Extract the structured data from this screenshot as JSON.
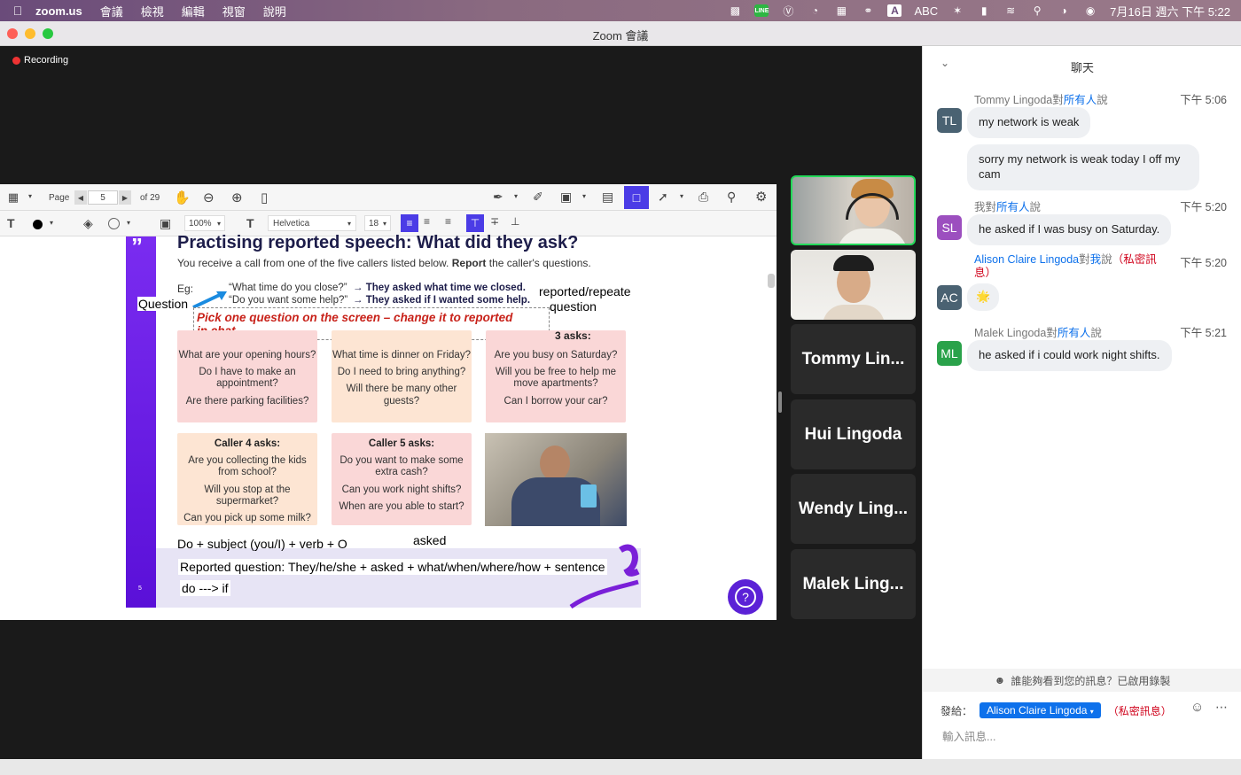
{
  "menubar": {
    "app_name": "zoom.us",
    "items": [
      "會議",
      "檢視",
      "編輯",
      "視窗",
      "說明"
    ],
    "input_method": "ABC",
    "datetime": "7月16日 週六 下午 5:22"
  },
  "window": {
    "title": "Zoom 會議"
  },
  "recording": {
    "label": "Recording"
  },
  "pdf_toolbar": {
    "page_label": "Page",
    "page_number": "5",
    "page_total": "of 29",
    "zoom": "100%",
    "font": "Helvetica",
    "font_size": "18"
  },
  "slide": {
    "title": "Practising reported speech: What did they ask?",
    "subtitle_pre": "You receive a call from one of the five callers listed below.",
    "subtitle_bold": "Report",
    "subtitle_post": "the caller's questions.",
    "eg_label": "Eg:",
    "eg_q1": "“What time do you close?”",
    "eg_a1": "→ They asked what time we closed.",
    "eg_q2": "“Do you want some help?”",
    "eg_a2": "→ They asked if I wanted some help.",
    "annot_question": "Question",
    "annot_reported": "reported/repeate",
    "annot_question2": "question",
    "annot_instruction_1": "Pick one question on the screen – change it to reported",
    "annot_instruction_2": "in chat",
    "caller3_header": "3 asks:",
    "card1": [
      "What are your opening hours?",
      "Do I have to make an appointment?",
      "Are there parking facilities?"
    ],
    "card2": [
      "What time is dinner on Friday?",
      "Do I need to bring anything?",
      "Will there be many other guests?"
    ],
    "card3": [
      "Are you busy on Saturday?",
      "Will you be free to help me move apartments?",
      "Can I borrow your car?"
    ],
    "card4_header": "Caller 4 asks:",
    "card4": [
      "Are you collecting the kids from school?",
      "Will you stop at the supermarket?",
      "Can you pick up some milk?"
    ],
    "card5_header": "Caller 5 asks:",
    "card5": [
      "Do you want to make some extra cash?",
      "Can you work night shifts?",
      "When are you able to start?"
    ],
    "formula1": "Do + subject (you/I) + verb + O",
    "asked": "asked",
    "formula2": "Reported question: They/he/she + asked + what/when/where/how + sentence",
    "formula3": "do ---> if",
    "page_num": "5",
    "help_btn": "?"
  },
  "participants": [
    {
      "name": ""
    },
    {
      "name": ""
    },
    {
      "name": "Tommy Lin..."
    },
    {
      "name": "Hui Lingoda"
    },
    {
      "name": "Wendy Ling..."
    },
    {
      "name": "Malek Ling..."
    }
  ],
  "chat": {
    "title": "聊天",
    "messages": [
      {
        "initials": "TL",
        "sender": "Tommy Lingoda",
        "to_prefix": "對",
        "to": "所有人",
        "suffix": "說",
        "time": "下午 5:06",
        "texts": [
          "my network is weak",
          "sorry my network is weak today I off my cam"
        ],
        "color": "#4a6272"
      },
      {
        "initials": "SL",
        "sender": "我",
        "to_prefix": "對",
        "to": "所有人",
        "suffix": "說",
        "time": "下午 5:20",
        "texts": [
          "he asked if I was busy on Saturday."
        ],
        "color": "#9c4fbf"
      },
      {
        "initials": "AC",
        "sender": "Alison Claire Lingoda",
        "to_prefix": "對",
        "to": "我",
        "suffix": "說",
        "private": "（私密訊息）",
        "time": "下午 5:20",
        "texts": [
          "🌟"
        ],
        "color": "#4a6272"
      },
      {
        "initials": "ML",
        "sender": "Malek Lingoda",
        "to_prefix": "對",
        "to": "所有人",
        "suffix": "說",
        "time": "下午 5:21",
        "texts": [
          "he asked if i could work night shifts."
        ],
        "color": "#2aa24a"
      }
    ],
    "privacy_notice": "誰能夠看到您的訊息？已啟用錄製",
    "send_to_label": "發給：",
    "recipient": "Alison Claire Lingoda",
    "private_label": "（私密訊息）",
    "input_placeholder": "輸入訊息..."
  }
}
